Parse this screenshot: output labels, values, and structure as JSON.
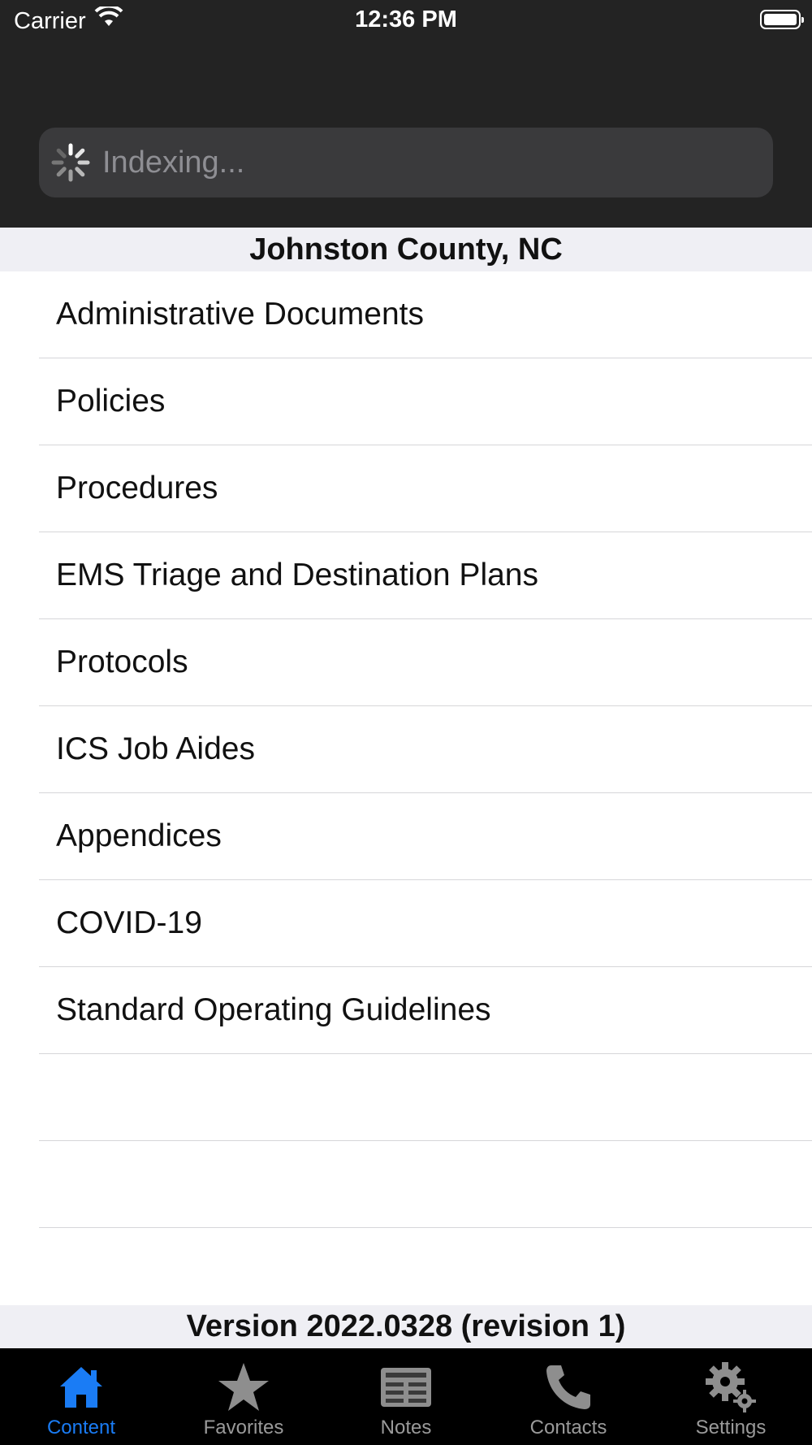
{
  "status_bar": {
    "carrier": "Carrier",
    "time": "12:36 PM"
  },
  "search": {
    "placeholder": "Indexing..."
  },
  "section_title": "Johnston County, NC",
  "items": [
    {
      "label": "Administrative Documents"
    },
    {
      "label": "Policies"
    },
    {
      "label": "Procedures"
    },
    {
      "label": "EMS Triage and Destination Plans"
    },
    {
      "label": "Protocols"
    },
    {
      "label": "ICS Job Aides"
    },
    {
      "label": "Appendices"
    },
    {
      "label": "COVID-19"
    },
    {
      "label": "Standard Operating Guidelines"
    },
    {
      "label": ""
    },
    {
      "label": ""
    }
  ],
  "version": "Version 2022.0328 (revision 1)",
  "tabbar": {
    "tabs": [
      {
        "label": "Content",
        "icon": "house-icon",
        "active": true
      },
      {
        "label": "Favorites",
        "icon": "star-icon",
        "active": false
      },
      {
        "label": "Notes",
        "icon": "notes-icon",
        "active": false
      },
      {
        "label": "Contacts",
        "icon": "phone-icon",
        "active": false
      },
      {
        "label": "Settings",
        "icon": "gear-icon",
        "active": false
      }
    ]
  },
  "colors": {
    "accent": "#1a7cf5",
    "nav_bg": "#232323",
    "tabbar_bg": "#000000",
    "section_bg": "#efeff4"
  }
}
